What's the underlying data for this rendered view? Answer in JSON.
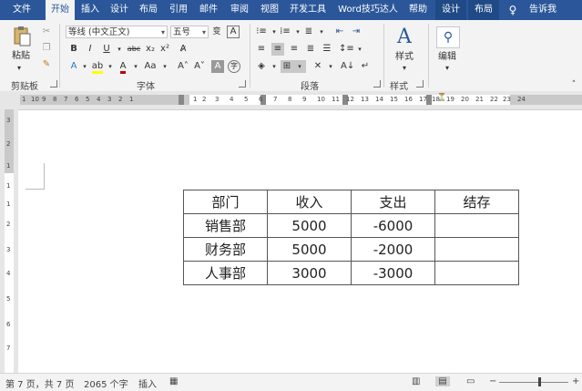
{
  "tabs": [
    {
      "label": "文件"
    },
    {
      "label": "开始"
    },
    {
      "label": "插入"
    },
    {
      "label": "设计"
    },
    {
      "label": "布局"
    },
    {
      "label": "引用"
    },
    {
      "label": "邮件"
    },
    {
      "label": "审阅"
    },
    {
      "label": "视图"
    },
    {
      "label": "开发工具"
    },
    {
      "label": "Word技巧达人"
    },
    {
      "label": "帮助"
    },
    {
      "label": "设计"
    },
    {
      "label": "布局"
    }
  ],
  "tell_me": "告诉我",
  "ribbon": {
    "clipboard": {
      "paste_label": "粘贴",
      "group_label": "剪贴板"
    },
    "font": {
      "font_name": "等线 (中文正文)",
      "font_size": "五号",
      "group_label": "字体"
    },
    "paragraph": {
      "group_label": "段落"
    },
    "styles": {
      "label": "样式",
      "group_label": "样式"
    },
    "editing": {
      "label": "编辑"
    }
  },
  "ruler_numbers": [
    "1",
    "10",
    "9",
    "8",
    "7",
    "6",
    "5",
    "4",
    "3",
    "2",
    "1",
    "1",
    "2",
    "3",
    "4",
    "5",
    "6",
    "7",
    "8",
    "9",
    "10",
    "11",
    "12",
    "13",
    "14",
    "15",
    "16",
    "17",
    "18",
    "19",
    "20",
    "21",
    "22",
    "23",
    "24"
  ],
  "vruler_numbers": [
    "3",
    "2",
    "1",
    "1",
    "1",
    "2",
    "3",
    "4",
    "5",
    "6",
    "7"
  ],
  "table": {
    "header": [
      "部门",
      "收入",
      "支出",
      "结存"
    ],
    "rows": [
      [
        "销售部",
        "5000",
        "-6000",
        ""
      ],
      [
        "财务部",
        "5000",
        "-2000",
        ""
      ],
      [
        "人事部",
        "3000",
        "-3000",
        ""
      ]
    ]
  },
  "status": {
    "page": "第 7 页，共 7 页",
    "words": "2065 个字",
    "mode": "插入"
  },
  "colors": {
    "ribbon_blue": "#2b579a",
    "font_color": "#c00000",
    "highlight": "#ffff00"
  }
}
